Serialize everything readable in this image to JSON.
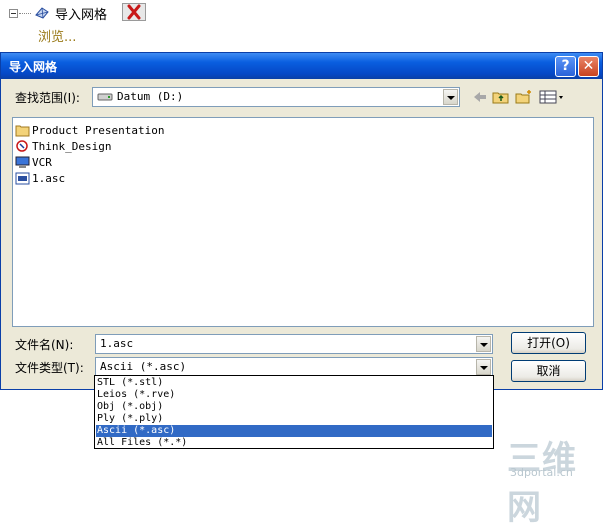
{
  "tree": {
    "title": "导入网格",
    "browse": "浏览..."
  },
  "dialog": {
    "title": "导入网格",
    "help": "?",
    "close": "✕",
    "lookin_label": "查找范围(I):",
    "lookin_value": "Datum (D:)",
    "files": [
      {
        "name": "Product Presentation",
        "icon": "folder-icon"
      },
      {
        "name": "Think_Design",
        "icon": "application-icon"
      },
      {
        "name": "VCR",
        "icon": "computer-icon"
      },
      {
        "name": "1.asc",
        "icon": "asc-file-icon"
      }
    ],
    "filename_label": "文件名(N):",
    "filename_value": "1.asc",
    "filetype_label": "文件类型(T):",
    "filetype_value": "Ascii (*.asc)",
    "open_label": "打开(O)",
    "cancel_label": "取消"
  },
  "dropdown": {
    "options": [
      "STL (*.stl)",
      "Leios (*.rve)",
      "Obj (*.obj)",
      "Ply (*.ply)",
      "Ascii (*.asc)",
      "All Files (*.*)"
    ],
    "selected_index": 4
  },
  "watermark": {
    "main": "三维网",
    "sub": "3dportal.cn"
  },
  "colors": {
    "titlebar": "#0a5fe0",
    "selection": "#316ac5",
    "dialog_bg": "#ece9d8",
    "link": "#9a7a18"
  }
}
